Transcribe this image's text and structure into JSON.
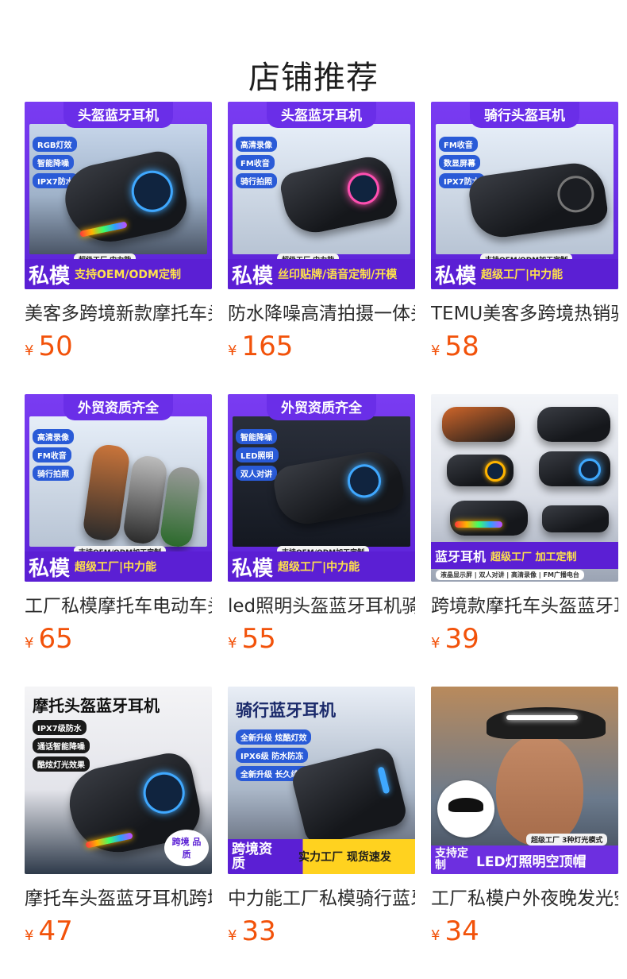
{
  "page": {
    "title": "店铺推荐"
  },
  "colors": {
    "price": "#f2520a",
    "accent_purple": "#5b1fd4"
  },
  "products": [
    {
      "name": "美客多跨境新款摩托车头盔蓝牙耳机",
      "currency": "¥",
      "price": "50",
      "image": {
        "banner": "头盔蓝牙耳机",
        "chips": [
          "RGB灯效",
          "智能降噪",
          "IPX7防水"
        ],
        "footer_big": "私模",
        "footer_small": "支持OEM/ODM定制",
        "footer_tag": "超级工厂 中力能"
      }
    },
    {
      "name": "防水降噪高清拍摄一体头盔蓝牙耳机",
      "currency": "¥",
      "price": "165",
      "image": {
        "banner": "头盔蓝牙耳机",
        "chips": [
          "高清录像",
          "FM收音",
          "骑行拍照"
        ],
        "footer_big": "私模",
        "footer_small": "丝印贴牌/语音定制/开模",
        "footer_tag": "超级工厂 中力能"
      }
    },
    {
      "name": "TEMU美客多跨境热销骑行头盔耳机",
      "currency": "¥",
      "price": "58",
      "image": {
        "banner": "骑行头盔耳机",
        "chips": [
          "FM收音",
          "数显屏幕",
          "IPX7防水"
        ],
        "footer_big": "私模",
        "footer_small": "超级工厂|中力能",
        "footer_tag": "支持OEM/ODM加工定制"
      }
    },
    {
      "name": "工厂私模摩托车电动车头盔蓝牙耳机",
      "currency": "¥",
      "price": "65",
      "image": {
        "banner": "外贸资质齐全",
        "chips": [
          "高清录像",
          "FM收音",
          "骑行拍照"
        ],
        "footer_big": "私模",
        "footer_small": "超级工厂|中力能",
        "footer_tag": "支持OEM/ODM加工定制"
      }
    },
    {
      "name": "led照明头盔蓝牙耳机骑行对讲",
      "currency": "¥",
      "price": "55",
      "image": {
        "banner": "外贸资质齐全",
        "chips": [
          "智能降噪",
          "LED照明",
          "双人对讲"
        ],
        "footer_big": "私模",
        "footer_small": "超级工厂|中力能",
        "footer_tag": "支持OEM/ODM加工定制"
      }
    },
    {
      "name": "跨境款摩托车头盔蓝牙耳机",
      "currency": "¥",
      "price": "39",
      "image": {
        "banner": "",
        "chips": [],
        "footer_big": "蓝牙耳机",
        "footer_small": "超级工厂 加工定制",
        "footer_tag": "液晶显示屏 | 双人对讲 | 高清录像 | FM广播电台"
      }
    },
    {
      "name": "摩托车头盔蓝牙耳机跨境品质",
      "currency": "¥",
      "price": "47",
      "image": {
        "banner": "",
        "title": "摩托头盔蓝牙耳机",
        "chips": [
          "IPX7级防水",
          "通话智能降噪",
          "酷炫灯光效果"
        ],
        "footer_big": "",
        "footer_small": "",
        "footer_tag": "跨境 品质"
      }
    },
    {
      "name": "中力能工厂私模骑行蓝牙耳机",
      "currency": "¥",
      "price": "33",
      "image": {
        "banner": "",
        "title": "骑行蓝牙耳机",
        "chips": [
          "全新升级 炫酷灯效",
          "IPX6级 防水防冻",
          "全新升级 长久续航"
        ],
        "footer_big": "跨境资质",
        "footer_small": "实力工厂 现货速发",
        "footer_tag": ""
      }
    },
    {
      "name": "工厂私模户外夜晚发光空顶帽",
      "currency": "¥",
      "price": "34",
      "image": {
        "banner": "",
        "chips": [],
        "footer_big": "支持定制",
        "footer_small": "LED灯照明空顶帽",
        "footer_tag": "超级工厂 3种灯光模式"
      }
    }
  ]
}
